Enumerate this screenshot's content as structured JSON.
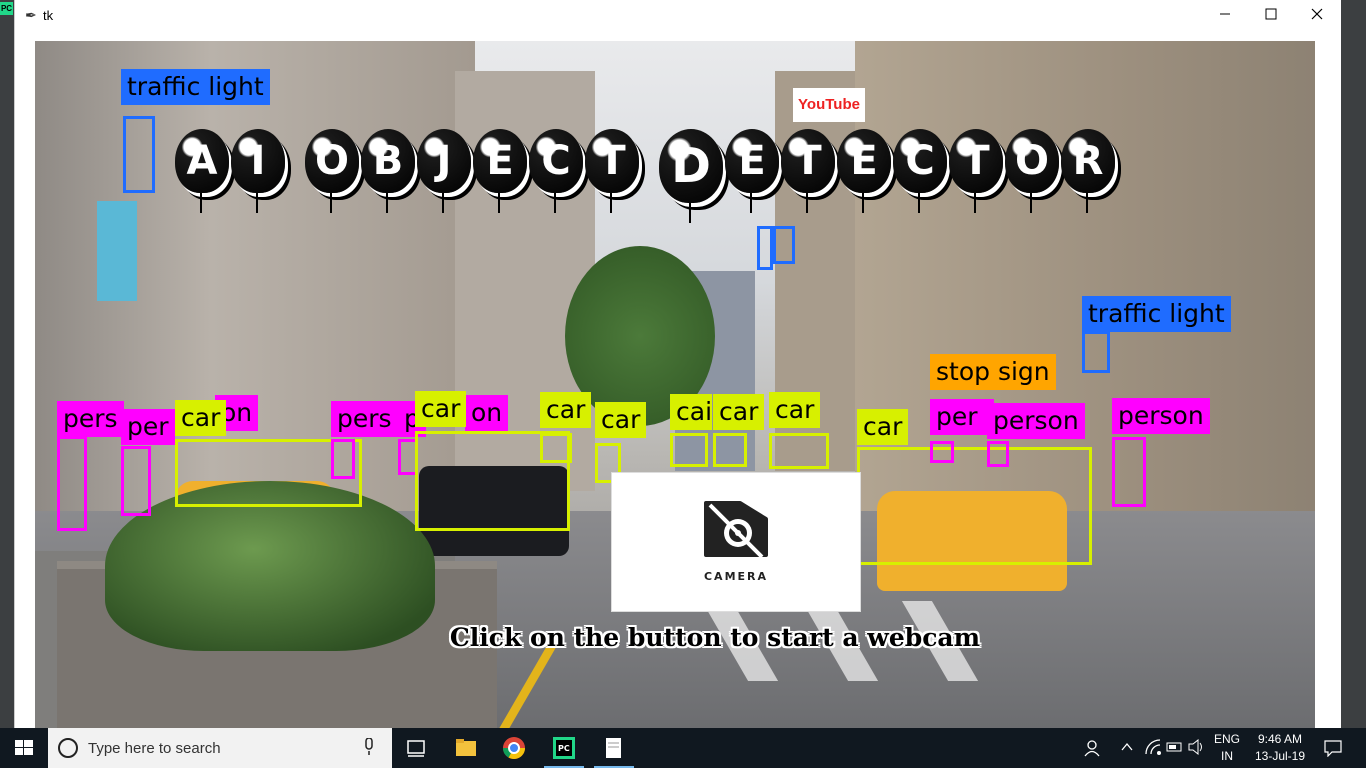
{
  "window": {
    "title": "tk",
    "minimize_icon": "minimize-icon",
    "maximize_icon": "maximize-icon",
    "close_icon": "close-icon"
  },
  "app": {
    "title_words": [
      [
        "A",
        "I"
      ],
      [
        "O",
        "B",
        "J",
        "E",
        "C",
        "T"
      ],
      [
        "D",
        "E",
        "T",
        "E",
        "C",
        "T",
        "O",
        "R"
      ]
    ],
    "camera_button": {
      "label": "CAMERA",
      "icon": "camera-icon"
    },
    "hint": "Click on the button to start a webcam",
    "video_sign": "YouTube"
  },
  "detections": [
    {
      "label": "traffic light",
      "color": "#1f6cff"
    },
    {
      "label": "traffic light",
      "color": "#1f6cff"
    },
    {
      "label": "stop sign",
      "color": "#ffa500"
    },
    {
      "label": "pers",
      "color": "#ff00ff"
    },
    {
      "label": "per",
      "color": "#ff00ff"
    },
    {
      "label": "on",
      "color": "#ff00ff"
    },
    {
      "label": "car",
      "color": "#d7f000"
    },
    {
      "label": "pers",
      "color": "#ff00ff"
    },
    {
      "label": "p",
      "color": "#ff00ff"
    },
    {
      "label": "on",
      "color": "#ff00ff"
    },
    {
      "label": "car",
      "color": "#d7f000"
    },
    {
      "label": "car",
      "color": "#d7f000"
    },
    {
      "label": "car",
      "color": "#d7f000"
    },
    {
      "label": "cai",
      "color": "#d7f000"
    },
    {
      "label": "car",
      "color": "#d7f000"
    },
    {
      "label": "car",
      "color": "#d7f000"
    },
    {
      "label": "car",
      "color": "#d7f000"
    },
    {
      "label": "per",
      "color": "#ff00ff"
    },
    {
      "label": "person",
      "color": "#ff00ff"
    },
    {
      "label": "person",
      "color": "#ff00ff"
    }
  ],
  "taskbar": {
    "search_placeholder": "Type here to search",
    "apps": [
      "task-view-icon",
      "file-explorer-icon",
      "chrome-icon",
      "pycharm-icon",
      "notepad-icon"
    ],
    "language_top": "ENG",
    "language_bottom": "IN",
    "time": "9:46 AM",
    "date": "13-Jul-19"
  }
}
